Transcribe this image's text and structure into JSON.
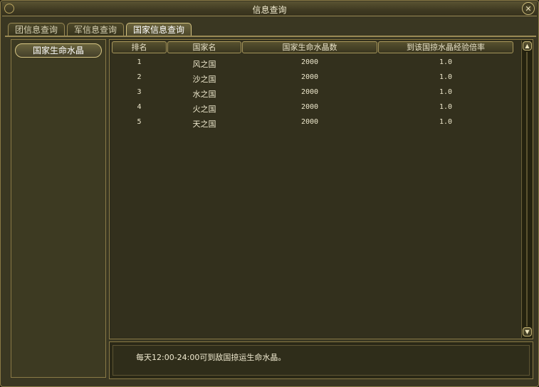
{
  "window": {
    "title": "信息查询",
    "close_label": "✕"
  },
  "tabs": [
    {
      "label": "团信息查询",
      "active": false
    },
    {
      "label": "军信息查询",
      "active": false
    },
    {
      "label": "国家信息查询",
      "active": true
    }
  ],
  "sidebar": {
    "selected_category": "国家生命水晶"
  },
  "table": {
    "columns": [
      "排名",
      "国家名",
      "国家生命水晶数",
      "到该国掠水晶经验倍率"
    ],
    "rows": [
      {
        "rank": "1",
        "name": "风之国",
        "crystals": "2000",
        "rate": "1.0"
      },
      {
        "rank": "2",
        "name": "沙之国",
        "crystals": "2000",
        "rate": "1.0"
      },
      {
        "rank": "3",
        "name": "水之国",
        "crystals": "2000",
        "rate": "1.0"
      },
      {
        "rank": "4",
        "name": "火之国",
        "crystals": "2000",
        "rate": "1.0"
      },
      {
        "rank": "5",
        "name": "天之国",
        "crystals": "2000",
        "rate": "1.0"
      }
    ]
  },
  "scrollbar": {
    "up_glyph": "▲",
    "down_glyph": "▼"
  },
  "info": {
    "text": "每天12:00-24:00可到敌国掠运生命水晶。"
  }
}
